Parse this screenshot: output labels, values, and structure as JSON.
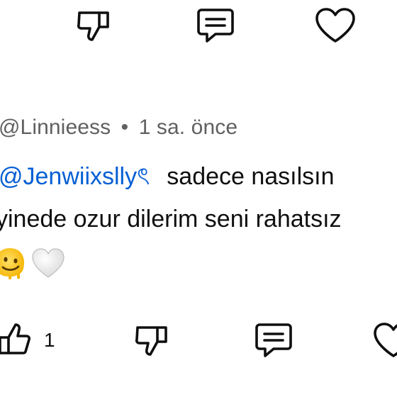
{
  "top_actions": {
    "dislike_icon": "thumbs-down-icon",
    "reply_icon": "comment-icon",
    "heart_icon": "heart-icon"
  },
  "comment": {
    "author": "@Linnieess",
    "separator": "•",
    "timestamp": "1 sa. önce",
    "mention": "@Jenwiixsllyৎ",
    "line1_text": "sadece nasılsın",
    "line2_text": "yinede ozur dilerim seni rahatsız",
    "emojis": [
      "melting-face-emoji",
      "white-heart-emoji"
    ]
  },
  "actions": {
    "like_icon": "thumbs-up-icon",
    "like_count": "1",
    "dislike_icon": "thumbs-down-icon",
    "reply_icon": "comment-icon",
    "heart_icon": "heart-icon"
  },
  "colors": {
    "text": "#0f0f0f",
    "meta": "#606060",
    "mention": "#065fd4",
    "icon": "#0f0f0f"
  }
}
